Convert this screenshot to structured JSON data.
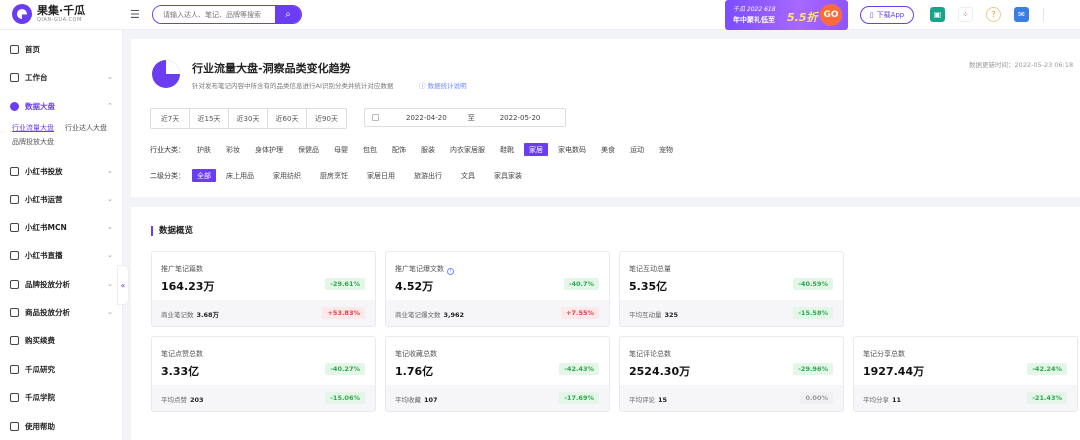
{
  "brand": {
    "name": "果集·千瓜",
    "sub": "QIAN-GUA.COM"
  },
  "search": {
    "placeholder": "请输入达人、笔记、品牌等搜索"
  },
  "banner": {
    "line1": "千瓜 2022 618",
    "line2": "年中聚礼低至",
    "discount": "5.5折",
    "go": "GO"
  },
  "download_label": "下载App",
  "sidebar": {
    "items": [
      {
        "label": "首页"
      },
      {
        "label": "工作台"
      },
      {
        "label": "数据大盘"
      },
      {
        "label": "小红书投放"
      },
      {
        "label": "小红书运营"
      },
      {
        "label": "小红书MCN"
      },
      {
        "label": "小红书直播"
      },
      {
        "label": "品牌投放分析"
      },
      {
        "label": "商品投放分析"
      },
      {
        "label": "购买续费"
      },
      {
        "label": "千瓜研究"
      },
      {
        "label": "千瓜学院"
      },
      {
        "label": "使用帮助"
      }
    ],
    "sub_items": [
      "行业流量大盘",
      "行业达人大盘",
      "品牌投放大盘"
    ],
    "collapse_glyph": "«"
  },
  "header": {
    "title": "行业流量大盘-洞察品类变化趋势",
    "desc": "针对发布笔记内容中所含有的品类信息进行AI识别分类并统计对应数据",
    "link": "数据统计说明",
    "updated": "数据更新时间：2022-05-23 06:18"
  },
  "ranges": [
    "近7天",
    "近15天",
    "近30天",
    "近60天",
    "近90天"
  ],
  "date_range": {
    "start": "2022-04-20",
    "sep": "至",
    "end": "2022-05-20"
  },
  "category": {
    "label": "行业大类：",
    "items": [
      "护肤",
      "彩妆",
      "身体护理",
      "保健品",
      "母婴",
      "包包",
      "配饰",
      "服装",
      "内衣家居服",
      "鞋靴",
      "家居",
      "家电数码",
      "美食",
      "运动",
      "宠物"
    ],
    "selected": "家居"
  },
  "subcategory": {
    "label": "二级分类：",
    "items": [
      "全部",
      "床上用品",
      "家用纺织",
      "厨房烹饪",
      "家居日用",
      "旅游出行",
      "文具",
      "家具家装"
    ],
    "selected": "全部"
  },
  "overview": {
    "title": "数据概览",
    "metrics": [
      {
        "label": "推广笔记篇数",
        "value": "164.23万",
        "change": "-29.61%",
        "sub_label": "商业笔记数",
        "sub_value": "3.68万",
        "sub_change": "+53.83%"
      },
      {
        "label": "推广笔记爆文数",
        "value": "4.52万",
        "change": "-40.7%",
        "sub_label": "商业笔记爆文数",
        "sub_value": "3,962",
        "sub_change": "+7.55%"
      },
      {
        "label": "笔记互动总量",
        "value": "5.35亿",
        "change": "-40.59%",
        "sub_label": "平均互动量",
        "sub_value": "325",
        "sub_change": "-15.58%"
      },
      {
        "label": "笔记点赞总数",
        "value": "3.33亿",
        "change": "-40.27%",
        "sub_label": "平均点赞",
        "sub_value": "203",
        "sub_change": "-15.06%"
      },
      {
        "label": "笔记收藏总数",
        "value": "1.76亿",
        "change": "-42.43%",
        "sub_label": "平均收藏",
        "sub_value": "107",
        "sub_change": "-17.69%"
      },
      {
        "label": "笔记评论总数",
        "value": "2524.30万",
        "change": "-29.96%",
        "sub_label": "平均评论",
        "sub_value": "15",
        "sub_change": "0.00%"
      },
      {
        "label": "笔记分享总数",
        "value": "1927.44万",
        "change": "-42.24%",
        "sub_label": "平均分享",
        "sub_value": "11",
        "sub_change": "-21.43%"
      }
    ]
  }
}
